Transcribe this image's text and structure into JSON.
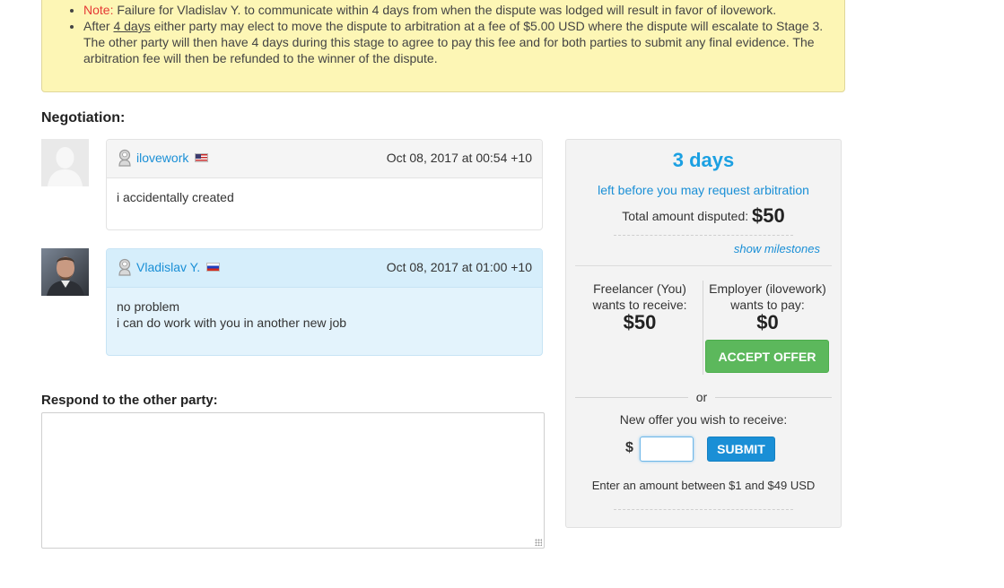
{
  "notice": {
    "note_label": "Note:",
    "note_text": " Failure for Vladislav Y. to communicate within 4 days from when the dispute was lodged will result in favor of ilovework.",
    "arbitration_pre": "After ",
    "arbitration_link": "4 days",
    "arbitration_post": " either party may elect to move the dispute to arbitration at a fee of $5.00 USD where the dispute will escalate to Stage 3. The other party will then have 4 days during this stage to agree to pay this fee and for both parties to submit any final evidence. The arbitration fee will then be refunded to the winner of the dispute."
  },
  "negotiation": {
    "title": "Negotiation:",
    "messages": [
      {
        "user": "ilovework",
        "flag": "us-flag",
        "date": "Oct 08, 2017 at 00:54 +10",
        "lines": [
          "i accidentally created"
        ]
      },
      {
        "user": "Vladislav Y.",
        "flag": "ru-flag",
        "date": "Oct 08, 2017 at 01:00 +10",
        "lines": [
          "no problem",
          "i can do work with you in another new job"
        ]
      }
    ]
  },
  "respond": {
    "title": "Respond to the other party:",
    "value": "",
    "placeholder": ""
  },
  "panel": {
    "days": "3 days",
    "days_sub": "left before you may request arbitration",
    "total_label": "Total amount disputed: ",
    "total_amount": "$50",
    "show_milestones": "show milestones",
    "freelancer_label_1": "Freelancer (You)",
    "freelancer_label_2": "wants to receive:",
    "freelancer_amount": "$50",
    "employer_label_1": "Employer (ilovework)",
    "employer_label_2": "wants to pay:",
    "employer_amount": "$0",
    "accept_label": "ACCEPT OFFER",
    "or_label": "or",
    "new_offer_label": "New offer you wish to receive:",
    "currency_symbol": "$",
    "offer_value": "",
    "submit_label": "SUBMIT",
    "range_text": "Enter an amount between $1 and $49 USD"
  },
  "colors": {
    "accent_blue": "#1a8fd6",
    "accept_green": "#5cb85c",
    "notice_bg": "#fdf6b5",
    "note_red": "#e53935"
  }
}
